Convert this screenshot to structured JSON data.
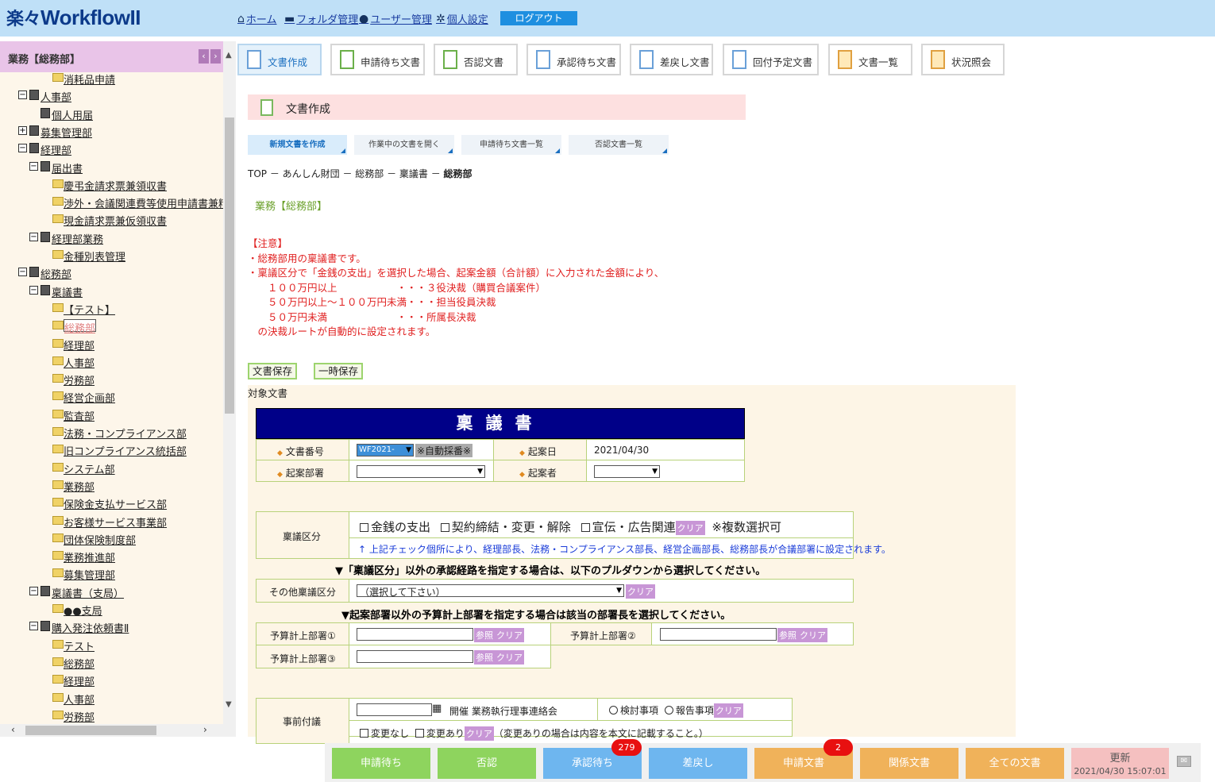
{
  "header": {
    "logo_raku": "楽々",
    "logo_text": "WorkflowII",
    "nav": [
      "ホーム",
      "フォルダ管理",
      "ユーザー管理",
      "個人設定"
    ],
    "logout": "ログアウト"
  },
  "sidebar": {
    "title": "業務【総務部】",
    "items": [
      "消耗品申請",
      "人事部",
      "個人用届",
      "募集管理部",
      "経理部",
      "届出書",
      "慶弔金請求票兼領収書",
      "渉外・会議関連費等使用申請書兼精",
      "現金請求票兼仮領収書",
      "経理部業務",
      "金種別表管理",
      "総務部",
      "稟議書",
      "【テスト】",
      "総務部",
      "経理部",
      "人事部",
      "労務部",
      "経営企画部",
      "監査部",
      "法務・コンプライアンス部",
      "旧コンプライアンス統括部",
      "システム部",
      "業務部",
      "保険金支払サービス部",
      "お客様サービス事業部",
      "団体保険制度部",
      "業務推進部",
      "募集管理部",
      "稟議書（支局）",
      "●●支局",
      "購入発注依頼書Ⅱ",
      "テスト",
      "総務部",
      "経理部",
      "人事部",
      "労務部"
    ]
  },
  "toolbar": [
    "文書作成",
    "申請待ち文書",
    "否認文書",
    "承認待ち文書",
    "差戻し文書",
    "回付予定文書",
    "文書一覧",
    "状況照会"
  ],
  "page": {
    "title": "文書作成",
    "subtabs": [
      "新規文書を作成",
      "作業中の文書を開く",
      "申請待ち文書一覧",
      "否認文書一覧"
    ],
    "breadcrumb": "TOP － あんしん財団 － 総務部 － 稟議書 － ",
    "breadcrumb_current": "総務部",
    "dept": "業務【総務部】",
    "notes": [
      "【注意】",
      "・総務部用の稟議書です。",
      "・稟議区分で「金銭の支出」を選択した場合、起案金額（合計額）に入力された金額により、",
      "　　１００万円以上　　　　　　・・・３役決裁（購買合議案件）",
      "　　５０万円以上～１００万円未満・・・担当役員決裁",
      "　　５０万円未満　　　　　　　・・・所属長決裁",
      "　の決裁ルートが自動的に設定されます。"
    ],
    "save": "文書保存",
    "temp_save": "一時保存",
    "target": "対象文書"
  },
  "form": {
    "title": "稟議書",
    "doc_no_label": "文書番号",
    "doc_no_value": "WF2021-",
    "auto_no": "※自動採番※",
    "date_label": "起案日",
    "date_value": "2021/04/30",
    "dept_label": "起案部署",
    "author_label": "起案者",
    "category_label": "稟議区分",
    "cat1": "金銭の支出",
    "cat2": "契約締結・変更・解除",
    "cat3": "宣伝・広告関連",
    "clear": "クリア",
    "multi": "※複数選択可",
    "cat_note": "↑ 上記チェック個所により、経理部長、法務・コンプライアンス部長、経営企画部長、総務部長が合議部署に設定されます。",
    "section1": "▼「稟議区分」以外の承認経路を指定する場合は、以下のプルダウンから選択してください。",
    "other_label": "その他稟議区分",
    "other_value": "（選択して下さい）",
    "section2": "▼起案部署以外の予算計上部署を指定する場合は該当の部署長を選択してください。",
    "budget1": "予算計上部署①",
    "budget2": "予算計上部署②",
    "budget3": "予算計上部署③",
    "ref": "参照",
    "pre_label": "事前付議",
    "pre_meeting": "開催 業務執行理事連絡会",
    "opt_review": "検討事項",
    "opt_report": "報告事項",
    "no_change": "変更なし",
    "changed": "変更あり",
    "change_note": "（変更ありの場合は内容を本文に記載すること。）"
  },
  "bottom": {
    "buttons": [
      "申請待ち",
      "否認",
      "承認待ち",
      "差戻し",
      "申請文書",
      "関係文書",
      "全ての文書"
    ],
    "badge_approval": "279",
    "badge_applied": "2",
    "update": "更新",
    "update_ts": "2021/04/30 15:07:01"
  },
  "colors": {
    "header_bg": "#bfe0f7",
    "sidebar_head": "#e9c4e8",
    "form_title_bg": "#000088",
    "bottom_green": "#8ed45e",
    "bottom_blue": "#6eb6ef",
    "bottom_orange": "#f0b25a"
  }
}
